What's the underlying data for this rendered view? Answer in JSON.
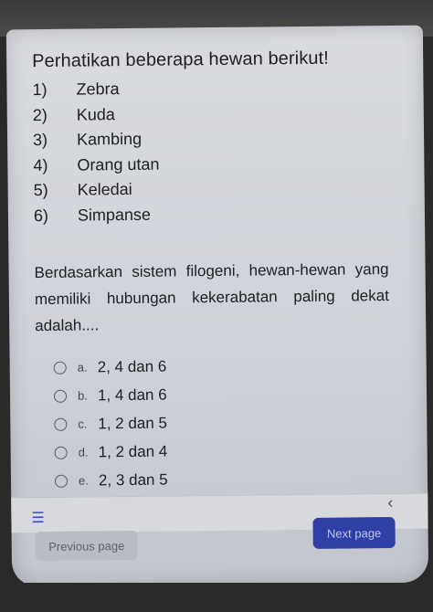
{
  "question_intro": "Perhatikan beberapa hewan berikut!",
  "animals": [
    {
      "num": "1)",
      "name": "Zebra"
    },
    {
      "num": "2)",
      "name": "Kuda"
    },
    {
      "num": "3)",
      "name": "Kambing"
    },
    {
      "num": "4)",
      "name": "Orang utan"
    },
    {
      "num": "5)",
      "name": "Keledai"
    },
    {
      "num": "6)",
      "name": "Simpanse"
    }
  ],
  "question_text": "Berdasarkan sistem filogeni, hewan-hewan yang memiliki hubungan kekerabatan paling dekat adalah....",
  "options": [
    {
      "letter": "a.",
      "text": "2, 4 dan 6"
    },
    {
      "letter": "b.",
      "text": "1, 4 dan 6"
    },
    {
      "letter": "c.",
      "text": "1, 2 dan 5"
    },
    {
      "letter": "d.",
      "text": "1, 2 dan 4"
    },
    {
      "letter": "e.",
      "text": "2, 3 dan 5"
    }
  ],
  "nav": {
    "menu_icon": "list-icon",
    "collapse_icon": "chevron-left-icon",
    "previous_label": "Previous page",
    "next_label": "Next page"
  },
  "colors": {
    "primary": "#2f3fa6",
    "menu_icon": "#3b4bd0"
  }
}
